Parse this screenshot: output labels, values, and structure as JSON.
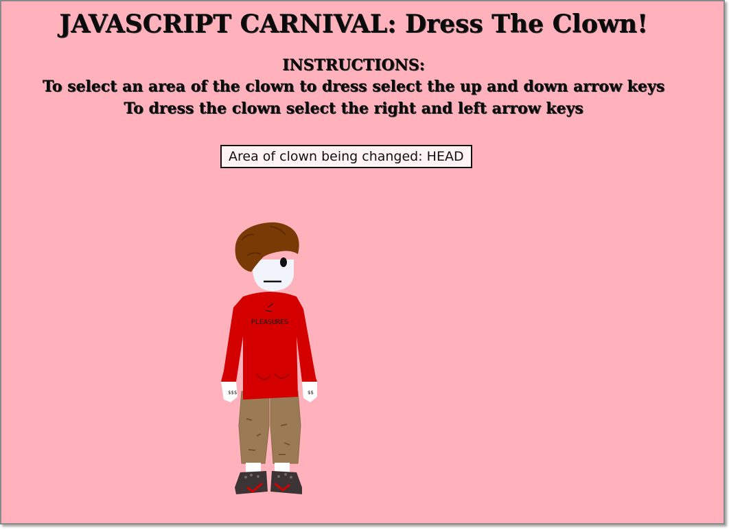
{
  "game": {
    "title": "JAVASCRIPT CARNIVAL: Dress The Clown!",
    "instructions": {
      "heading": "INSTRUCTIONS:",
      "line1": "To select an area of the clown to dress select the up and down arrow keys",
      "line2": "To dress the clown select the right and left arrow keys"
    },
    "status_text": "Area of clown being changed: HEAD",
    "clown": {
      "shirt_text": "PLEASURES",
      "hand_marks_left": "$$$",
      "hand_marks_right": "$$"
    }
  },
  "colors": {
    "background": "#ffb1bc",
    "hair": "#7a3a05",
    "shirt": "#d40000",
    "pants": "#9b7b55",
    "shoes": "#3c3434",
    "shoe_accent": "#d40000",
    "skin": "#ffffff"
  }
}
